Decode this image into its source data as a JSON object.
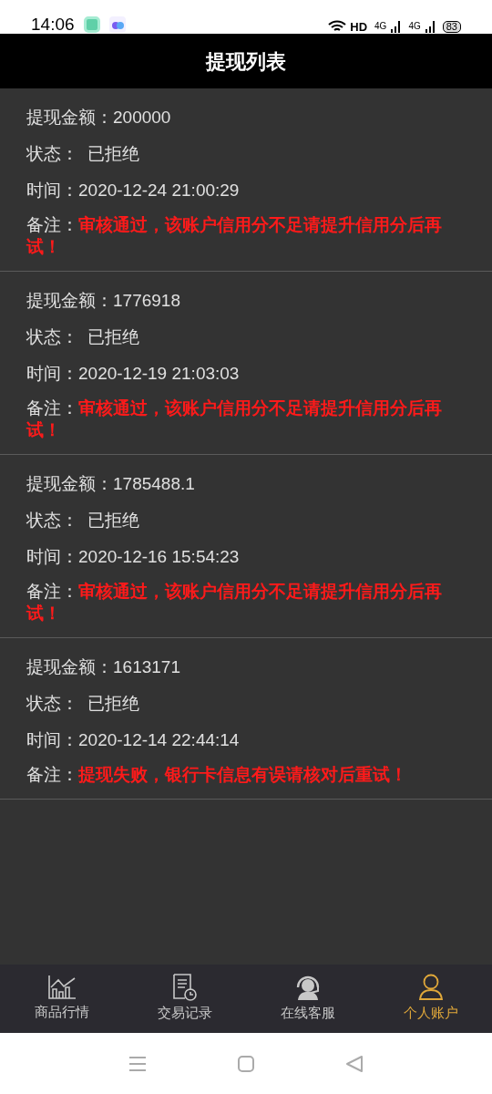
{
  "status_bar": {
    "time": "14:06",
    "hd": "HD",
    "network_1": "4G",
    "network_2": "4G",
    "battery": "83"
  },
  "header": {
    "title": "提现列表"
  },
  "records": [
    {
      "amount_label": "提现金额：",
      "amount": "200000",
      "status_label": "状态：",
      "status": "已拒绝",
      "time_label": "时间：",
      "time": "2020-12-24 21:00:29",
      "note_label": "备注：",
      "note": "审核通过，该账户信用分不足请提升信用分后再试！"
    },
    {
      "amount_label": "提现金额：",
      "amount": "1776918",
      "status_label": "状态：",
      "status": "已拒绝",
      "time_label": "时间：",
      "time": "2020-12-19 21:03:03",
      "note_label": "备注：",
      "note": "审核通过，该账户信用分不足请提升信用分后再试！"
    },
    {
      "amount_label": "提现金额：",
      "amount": "1785488.1",
      "status_label": "状态：",
      "status": "已拒绝",
      "time_label": "时间：",
      "time": "2020-12-16 15:54:23",
      "note_label": "备注：",
      "note": "审核通过，该账户信用分不足请提升信用分后再试！"
    },
    {
      "amount_label": "提现金额：",
      "amount": "1613171",
      "status_label": "状态：",
      "status": "已拒绝",
      "time_label": "时间：",
      "time": "2020-12-14 22:44:14",
      "note_label": "备注：",
      "note": "提现失败，银行卡信息有误请核对后重试！"
    }
  ],
  "tab_bar": [
    {
      "kind": "chart",
      "label": "商品行情",
      "selected": false
    },
    {
      "kind": "record",
      "label": "交易记录",
      "selected": false
    },
    {
      "kind": "support",
      "label": "在线客服",
      "selected": false
    },
    {
      "kind": "account",
      "label": "个人账户",
      "selected": true
    }
  ]
}
